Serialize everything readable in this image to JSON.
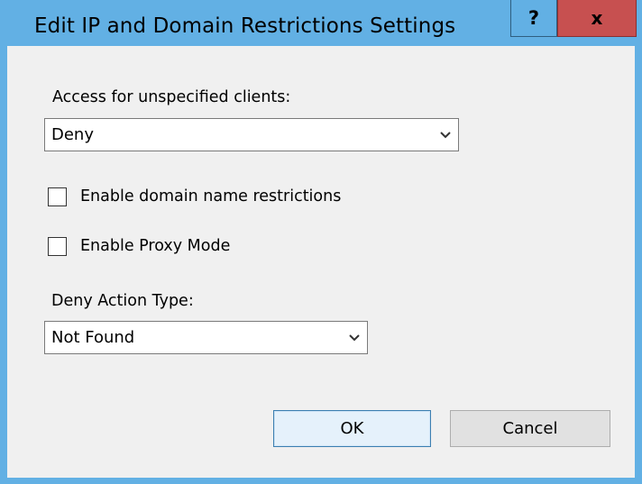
{
  "window": {
    "title": "Edit IP and Domain Restrictions Settings",
    "help_label": "?",
    "close_label": "x"
  },
  "access": {
    "label": "Access for unspecified clients:",
    "selected": "Deny",
    "icon": "chevron-down-icon"
  },
  "options": {
    "domain_restrictions_label": "Enable domain name restrictions",
    "domain_restrictions_checked": false,
    "proxy_mode_label": "Enable Proxy Mode",
    "proxy_mode_checked": false
  },
  "deny_action": {
    "label": "Deny Action Type:",
    "selected": "Not Found",
    "icon": "chevron-down-icon"
  },
  "buttons": {
    "ok_label": "OK",
    "cancel_label": "Cancel"
  },
  "colors": {
    "titlebar": "#62b0e4",
    "close": "#c75050",
    "content": "#f0f0f0"
  }
}
